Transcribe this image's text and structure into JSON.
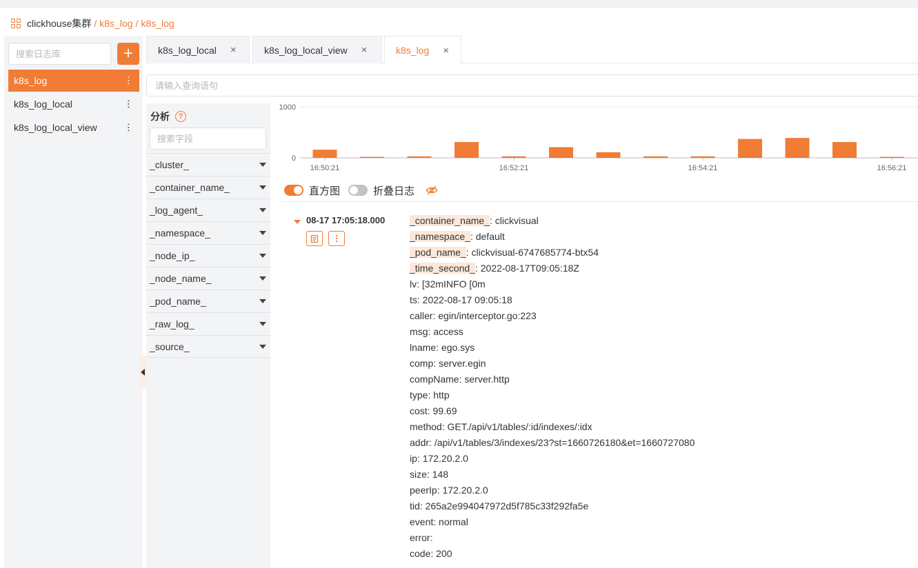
{
  "breadcrumb": {
    "root": "clickhouse集群",
    "sep": "/",
    "db": "k8s_log",
    "table": "k8s_log"
  },
  "sidebar": {
    "search_placeholder": "搜索日志库",
    "add_label": "+",
    "items": [
      {
        "label": "k8s_log",
        "active": true
      },
      {
        "label": "k8s_log_local",
        "active": false
      },
      {
        "label": "k8s_log_local_view",
        "active": false
      }
    ]
  },
  "tabs": [
    {
      "label": "k8s_log_local",
      "close": "×"
    },
    {
      "label": "k8s_log_local_view",
      "close": "×"
    },
    {
      "label": "k8s_log",
      "close": "×",
      "active": true
    }
  ],
  "query": {
    "placeholder": "请输入查询语句"
  },
  "fields": {
    "title": "分析",
    "help": "?",
    "search_placeholder": "搜索字段",
    "items": [
      "_cluster_",
      "_container_name_",
      "_log_agent_",
      "_namespace_",
      "_node_ip_",
      "_node_name_",
      "_pod_name_",
      "_raw_log_",
      "_source_"
    ]
  },
  "chart_data": {
    "type": "bar",
    "y_ticks": [
      "1000",
      "0"
    ],
    "ylim": [
      0,
      1000
    ],
    "x_ticks": [
      "16:50:21",
      "16:52:21",
      "16:54:21",
      "16:56:21"
    ],
    "values": [
      160,
      10,
      30,
      310,
      30,
      210,
      110,
      30,
      30,
      370,
      390,
      310,
      10
    ],
    "bar_color": "#f07c36"
  },
  "toggles": {
    "histogram": "直方图",
    "fold": "折叠日志"
  },
  "log": {
    "time": "08-17 17:05:18.000",
    "fields": [
      {
        "key": "_container_name_",
        "value": "clickvisual",
        "hl": true
      },
      {
        "key": "_namespace_",
        "value": "default",
        "hl": true
      },
      {
        "key": "_pod_name_",
        "value": "clickvisual-6747685774-btx54",
        "hl": true
      },
      {
        "key": "_time_second_",
        "value": "2022-08-17T09:05:18Z",
        "hl": true
      },
      {
        "key": "lv",
        "value": " [32mINFO [0m",
        "hl": false
      },
      {
        "key": "ts",
        "value": "2022-08-17 09:05:18",
        "hl": false
      },
      {
        "key": "caller",
        "value": "egin/interceptor.go:223",
        "hl": false
      },
      {
        "key": "msg",
        "value": "access",
        "hl": false
      },
      {
        "key": "lname",
        "value": "ego.sys",
        "hl": false
      },
      {
        "key": "comp",
        "value": "server.egin",
        "hl": false
      },
      {
        "key": "compName",
        "value": "server.http",
        "hl": false
      },
      {
        "key": "type",
        "value": "http",
        "hl": false
      },
      {
        "key": "cost",
        "value": "99.69",
        "hl": false
      },
      {
        "key": "method",
        "value": "GET./api/v1/tables/:id/indexes/:idx",
        "hl": false
      },
      {
        "key": "addr",
        "value": "/api/v1/tables/3/indexes/23?st=1660726180&et=1660727080",
        "hl": false
      },
      {
        "key": "ip",
        "value": "172.20.2.0",
        "hl": false
      },
      {
        "key": "size",
        "value": "148",
        "hl": false
      },
      {
        "key": "peerIp",
        "value": "172.20.2.0",
        "hl": false
      },
      {
        "key": "tid",
        "value": "265a2e994047972d5f785c33f292fa5e",
        "hl": false
      },
      {
        "key": "event",
        "value": "normal",
        "hl": false
      },
      {
        "key": "error",
        "value": "",
        "hl": false
      },
      {
        "key": "code",
        "value": "200",
        "hl": false
      }
    ]
  }
}
